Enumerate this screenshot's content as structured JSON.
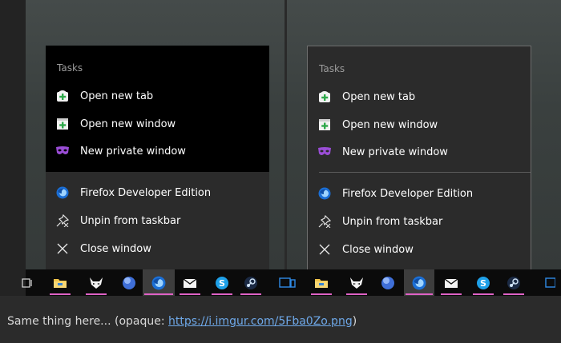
{
  "left_menu": {
    "heading": "Tasks",
    "items": [
      {
        "label": "Open new tab",
        "icon": "new-tab-icon"
      },
      {
        "label": "Open new window",
        "icon": "new-window-icon"
      },
      {
        "label": "New private window",
        "icon": "private-mask-icon"
      },
      {
        "label": "Firefox Developer Edition",
        "icon": "firefox-dev-icon"
      },
      {
        "label": "Unpin from taskbar",
        "icon": "unpin-icon"
      },
      {
        "label": "Close window",
        "icon": "close-icon"
      }
    ]
  },
  "right_menu": {
    "heading": "Tasks",
    "items": [
      {
        "label": "Open new tab",
        "icon": "new-tab-icon"
      },
      {
        "label": "Open new window",
        "icon": "new-window-icon"
      },
      {
        "label": "New private window",
        "icon": "private-mask-icon"
      },
      {
        "label": "Firefox Developer Edition",
        "icon": "firefox-dev-icon"
      },
      {
        "label": "Unpin from taskbar",
        "icon": "unpin-icon"
      },
      {
        "label": "Close window",
        "icon": "close-icon"
      }
    ]
  },
  "caption": {
    "text": "Same thing here... (opaque: ",
    "link": "https://i.imgur.com/5Fba0Zo.png",
    "close": ")"
  },
  "colors": {
    "accent_underline": "#e062c6",
    "link": "#6ea8e8",
    "menu_bg": "#2b2b2b",
    "black_block": "#000000"
  }
}
